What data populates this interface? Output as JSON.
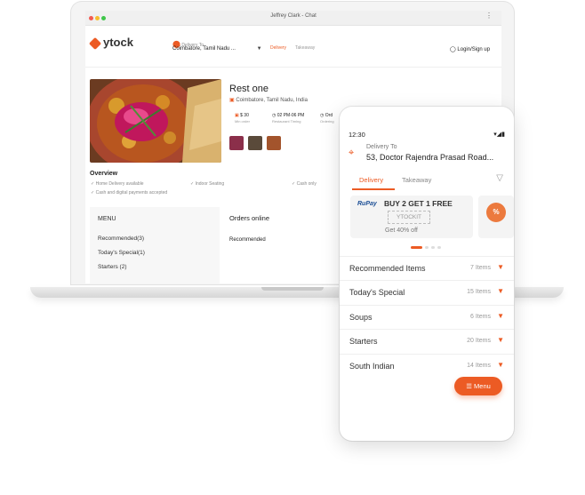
{
  "window": {
    "title": "Jeffrey Clark - Chat"
  },
  "web": {
    "brand": "ytock",
    "delivery_label": "Delivery To",
    "delivery_address": "Coimbatore, Tamil Nadu ...",
    "mode_delivery": "Delivery",
    "mode_takeaway": "Takeaway",
    "login": "Login/Sign up",
    "restaurant": {
      "name": "Rest one",
      "location": "Coimbatore, Tamil Nadu, India",
      "stats": [
        {
          "value": "$ 30",
          "label": "Min order"
        },
        {
          "value": "02 PM-06 PM",
          "label": "Restaurant Timing"
        },
        {
          "value": "Ord",
          "label": "Ordering"
        }
      ]
    },
    "overview": {
      "title": "Overview",
      "items": [
        "Home Delivery available",
        "Indoor Seating",
        "Cash only",
        "Cash and digital payments accepted"
      ]
    },
    "menu": {
      "title": "MENU",
      "items": [
        "Recommended(3)",
        "Today's Special(1)",
        "Starters (2)"
      ]
    },
    "orders_title": "Orders online",
    "recommended": "Recommended"
  },
  "phone": {
    "time": "12:30",
    "status": "▾◢▮",
    "delivery_to": "Delivery To",
    "address": "53, Doctor Rajendra Prasad Road...",
    "tab_delivery": "Delivery",
    "tab_takeaway": "Takeaway",
    "offer": {
      "brand": "RuPay",
      "title": "BUY 2 GET 1 FREE",
      "code": "YTOCKIT",
      "subtitle": "Get 40% off"
    },
    "categories": [
      {
        "name": "Recommended Items",
        "count": "7 Items"
      },
      {
        "name": "Today's Special",
        "count": "15 Items"
      },
      {
        "name": "Soups",
        "count": "6 Items"
      },
      {
        "name": "Starters",
        "count": "20 Items"
      },
      {
        "name": "South Indian",
        "count": "14 Items"
      }
    ],
    "menu_button": "Menu"
  },
  "colors": {
    "accent": "#ec5b24",
    "rupay": "#1b4e95"
  }
}
